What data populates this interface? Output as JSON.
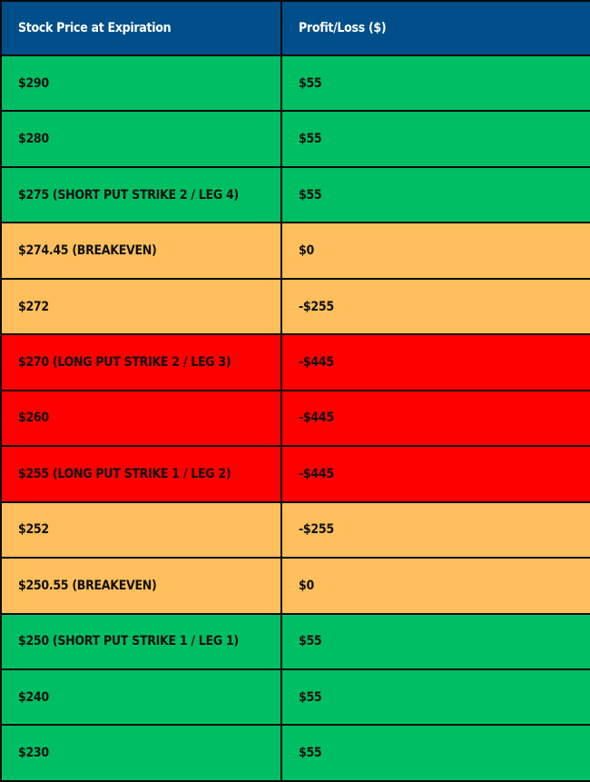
{
  "table": {
    "headers": [
      "Stock Price at Expiration",
      "Profit/Loss ($)"
    ],
    "rows": [
      {
        "price": "$290",
        "pl": "$55",
        "status": "green"
      },
      {
        "price": "$280",
        "pl": "$55",
        "status": "green"
      },
      {
        "price": "$275 (SHORT PUT STRIKE 2 / LEG 4)",
        "pl": "$55",
        "status": "green"
      },
      {
        "price": "$274.45 (BREAKEVEN)",
        "pl": "$0",
        "status": "amber"
      },
      {
        "price": "$272",
        "pl": "-$255",
        "status": "amber"
      },
      {
        "price": "$270 (LONG PUT STRIKE 2 / LEG 3)",
        "pl": "-$445",
        "status": "red"
      },
      {
        "price": "$260",
        "pl": "-$445",
        "status": "red"
      },
      {
        "price": "$255 (LONG PUT STRIKE 1 / LEG 2)",
        "pl": "-$445",
        "status": "red"
      },
      {
        "price": "$252",
        "pl": "-$255",
        "status": "amber"
      },
      {
        "price": "$250.55 (BREAKEVEN)",
        "pl": "$0",
        "status": "amber"
      },
      {
        "price": "$250 (SHORT PUT STRIKE 1 / LEG 1)",
        "pl": "$55",
        "status": "green"
      },
      {
        "price": "$240",
        "pl": "$55",
        "status": "green"
      },
      {
        "price": "$230",
        "pl": "$55",
        "status": "green"
      }
    ]
  },
  "colors": {
    "header": "#004f8a",
    "profit": "#00bf63",
    "breakeven_zone": "#ffbf5c",
    "max_loss": "#ff0000"
  }
}
